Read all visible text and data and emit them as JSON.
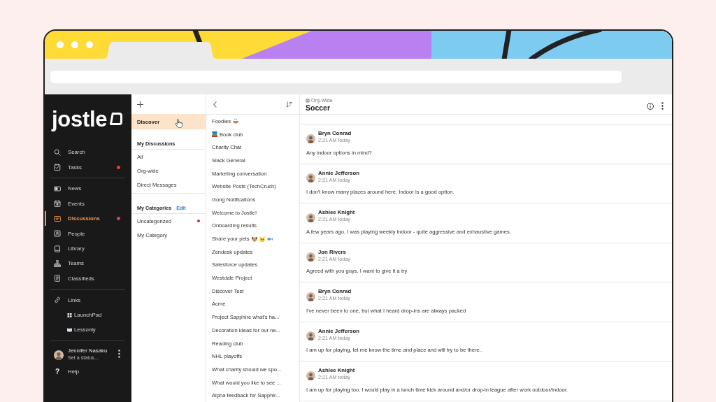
{
  "sidebar": {
    "logo": "jostle",
    "groups": [
      [
        {
          "label": "Search",
          "kind": "search",
          "selected": false,
          "unread": false
        },
        {
          "label": "Tasks",
          "kind": "tasks",
          "selected": false,
          "unread": true
        }
      ],
      [
        {
          "label": "News",
          "kind": "news",
          "selected": false,
          "unread": false
        },
        {
          "label": "Events",
          "kind": "events",
          "selected": false,
          "unread": false
        },
        {
          "label": "Discussions",
          "kind": "discussions",
          "selected": true,
          "unread": true
        },
        {
          "label": "People",
          "kind": "people",
          "selected": false,
          "unread": false
        },
        {
          "label": "Library",
          "kind": "library",
          "selected": false,
          "unread": false
        },
        {
          "label": "Teams",
          "kind": "teams",
          "selected": false,
          "unread": false
        },
        {
          "label": "Classifieds",
          "kind": "classifieds",
          "selected": false,
          "unread": false
        }
      ],
      [
        {
          "label": "Links",
          "kind": "links",
          "selected": false,
          "unread": false,
          "children": [
            {
              "label": "LaunchPad",
              "kind": "grid"
            },
            {
              "label": "Lessonly",
              "kind": "book"
            }
          ]
        }
      ]
    ],
    "user": {
      "name": "Jennifer Nasaku",
      "status": "Set a status..."
    },
    "help": {
      "icon": "?",
      "label": "Help"
    }
  },
  "categories": {
    "discover": {
      "label": "Discover",
      "selected": true,
      "hovered": true
    },
    "sections": [
      {
        "heading": "My Discussions",
        "items": [
          {
            "label": "All",
            "selected": false,
            "unread": false
          },
          {
            "label": "Org-wide",
            "selected": false,
            "unread": false
          },
          {
            "label": "Direct Messages",
            "selected": false,
            "unread": false
          }
        ]
      },
      {
        "heading": "My Categories",
        "action": "Edit",
        "items": [
          {
            "label": "Uncategorized",
            "selected": false,
            "unread": true
          },
          {
            "label": "My Category",
            "selected": false,
            "unread": false
          }
        ]
      }
    ]
  },
  "discussions": {
    "items": [
      {
        "title": "Foodies",
        "kind": "bowl",
        "selected": false
      },
      {
        "title": "Book club",
        "kind": "books",
        "selected": false
      },
      {
        "title": "Charity Chat",
        "kind": "plain",
        "selected": false
      },
      {
        "title": "Slack General",
        "kind": "plain",
        "selected": false
      },
      {
        "title": "Marketing conversation",
        "kind": "plain",
        "selected": false
      },
      {
        "title": "Website Posts (TechCruch)",
        "kind": "plain",
        "selected": false
      },
      {
        "title": "Gong Notifications",
        "kind": "plain",
        "selected": false
      },
      {
        "title": "Welcome to Jostle!",
        "kind": "plain",
        "selected": false
      },
      {
        "title": "Onboarding results",
        "kind": "plain",
        "selected": false
      },
      {
        "title": "Share your pets",
        "kind": "pets",
        "selected": false
      },
      {
        "title": "Zendesk updates",
        "kind": "plain",
        "selected": false
      },
      {
        "title": "Salesforce updates",
        "kind": "plain",
        "selected": false
      },
      {
        "title": "Westdale Project",
        "kind": "plain",
        "selected": false
      },
      {
        "title": "Discover Test",
        "kind": "plain",
        "selected": false
      },
      {
        "title": "Acme",
        "kind": "plain",
        "selected": false
      },
      {
        "title": "Project Sapphire what's ha...",
        "kind": "plain",
        "selected": false
      },
      {
        "title": "Decoration ideas for our ne...",
        "kind": "plain",
        "selected": false
      },
      {
        "title": "Reading club",
        "kind": "plain",
        "selected": false
      },
      {
        "title": "NHL playoffs",
        "kind": "plain",
        "selected": false
      },
      {
        "title": "What charity should we spo...",
        "kind": "plain",
        "selected": false
      },
      {
        "title": "What would you like to see ...",
        "kind": "plain",
        "selected": false
      },
      {
        "title": "Alpha feedback for Sapphir...",
        "kind": "plain",
        "selected": false
      }
    ]
  },
  "conversation": {
    "scope": "Org-Wide",
    "title": "Soccer",
    "messages": [
      {
        "author": "Bryn Conrad",
        "time": "2:21 AM today",
        "text": "Any indoor options in mind?"
      },
      {
        "author": "Annie Jefferson",
        "time": "2:21 AM today",
        "text": "I don't know many places around here. Indoor is a good option."
      },
      {
        "author": "Ashlee Knight",
        "time": "2:21 AM today",
        "text": "A few years ago, I was playing weekly indoor - quite aggressive and exhaustive games."
      },
      {
        "author": "Jon Rivers",
        "time": "2:21 AM today",
        "text": "Agreed with you guys, I want to give it a try"
      },
      {
        "author": "Bryn Conrad",
        "time": "2:21 AM today",
        "text": "I've never been to one, but what I heard drop-ins are always packed"
      },
      {
        "author": "Annie Jefferson",
        "time": "2:21 AM today",
        "text": "I am up for playing, let me know the time and place and will try to be there.."
      },
      {
        "author": "Ashlee Knight",
        "time": "2:21 AM today",
        "text": "I am up for playing too. I would play in a lunch time kick around and/or drop-in league after work outdoor/indoor."
      }
    ]
  }
}
